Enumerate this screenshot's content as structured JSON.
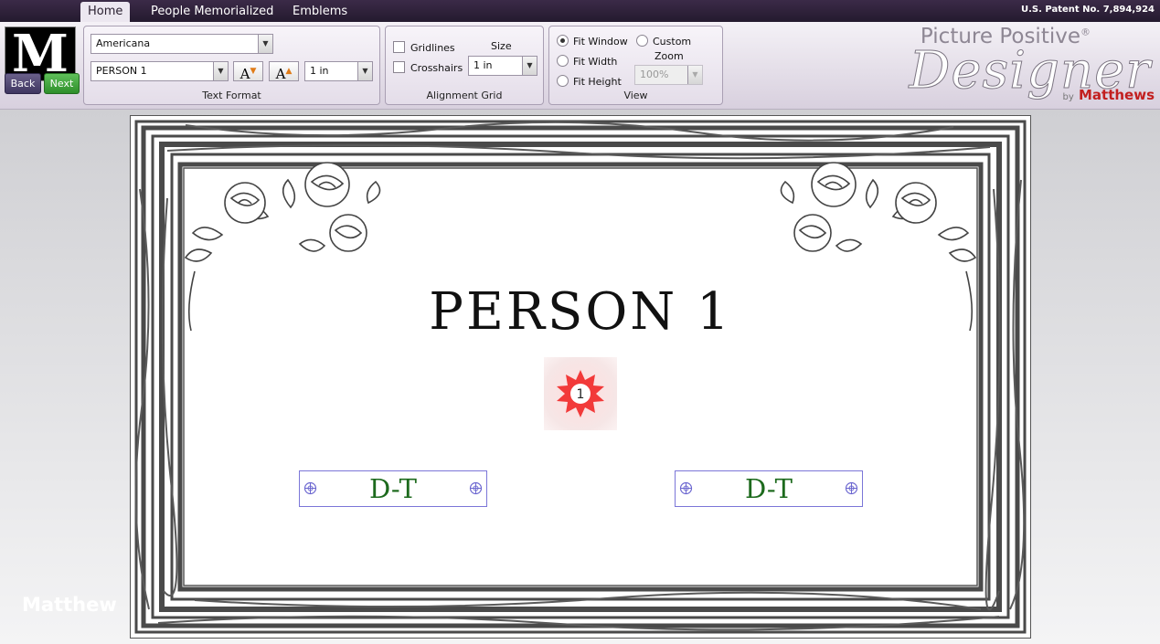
{
  "menu": {
    "tabs": [
      {
        "label": "Home",
        "active": true
      },
      {
        "label": "People Memorialized",
        "active": false
      },
      {
        "label": "Emblems",
        "active": false
      }
    ],
    "patent": "U.S. Patent No. 7,894,924"
  },
  "logo": {
    "letter": "M"
  },
  "nav": {
    "back_label": "Back",
    "next_label": "Next"
  },
  "text_format": {
    "font": "Americana",
    "field": "PERSON 1",
    "size": "1 in",
    "group_label": "Text Format"
  },
  "alignment_grid": {
    "gridlines_label": "Gridlines",
    "crosshairs_label": "Crosshairs",
    "size_label": "Size",
    "size_value": "1 in",
    "gridlines_checked": false,
    "crosshairs_checked": false,
    "group_label": "Alignment Grid"
  },
  "view": {
    "fit_window_label": "Fit Window",
    "fit_width_label": "Fit Width",
    "fit_height_label": "Fit Height",
    "custom_label": "Custom",
    "zoom_label": "Zoom",
    "zoom_value": "100%",
    "selected": "Fit Window",
    "group_label": "View"
  },
  "brand": {
    "line1": "Picture Positive",
    "reg": "®",
    "line2": "Designer",
    "by": "by",
    "company": "Matthews"
  },
  "workarea": {
    "watermark": "Matthew"
  },
  "design": {
    "name": "PERSON 1",
    "emblem_number": "1",
    "date_left": "D-T",
    "date_right": "D-T"
  },
  "colors": {
    "menubar": "#2e2239",
    "date_text": "#1d6a1d",
    "date_box_border": "#7b76d8",
    "emblem_red": "#f23a3a",
    "brand_red": "#c21f1f"
  }
}
